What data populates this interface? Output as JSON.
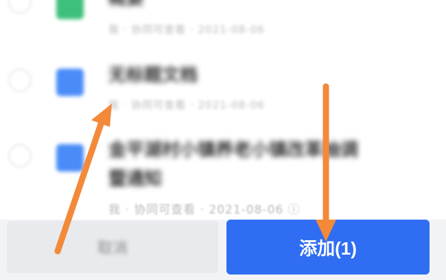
{
  "file_list": {
    "items": [
      {
        "title": "概要",
        "meta": "我 · 协同可查看 · 2021-08-06",
        "icon": "doc-green-icon"
      },
      {
        "title": "无标题文档",
        "meta": "我 · 协同可查看 · 2021-08-06",
        "icon": "doc-blue-icon"
      },
      {
        "title_line1": "金平湖村小镇养老小镇改革抽调",
        "title_line2": "暨通知",
        "meta": "我 · 协同可查看 · 2021-08-06 ⓘ",
        "icon": "doc-blue-icon"
      }
    ]
  },
  "footer": {
    "cancel_label": "取消",
    "add_label": "添加(1)"
  },
  "colors": {
    "accent": "#2f6ef2",
    "annotation_arrow": "#f28a3a"
  }
}
